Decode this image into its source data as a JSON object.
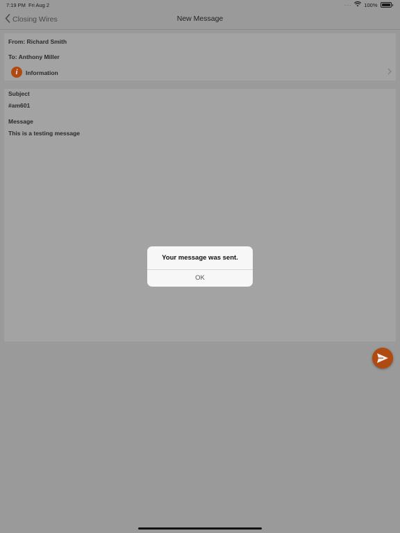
{
  "status_bar": {
    "time": "7:19 PM",
    "date": "Fri Aug 2",
    "cell": "....",
    "battery_pct": "100%"
  },
  "nav": {
    "back_label": "Closing Wires",
    "title": "New Message"
  },
  "header_card": {
    "from": "From: Richard Smith",
    "to": "To: Anthony Miller",
    "info_label": "Information"
  },
  "body_card": {
    "subject_label": "Subject",
    "subject_value": "#am601",
    "message_label": "Message",
    "message_value": "This is a testing message"
  },
  "alert": {
    "message": "Your message was sent.",
    "ok_label": "OK"
  },
  "colors": {
    "accent": "#b04a10",
    "overlay_bg": "#9a9a9a"
  },
  "icons": {
    "back": "chevron-left-icon",
    "info": "info-icon",
    "send": "send-icon",
    "wifi": "wifi-icon",
    "battery": "battery-icon"
  }
}
